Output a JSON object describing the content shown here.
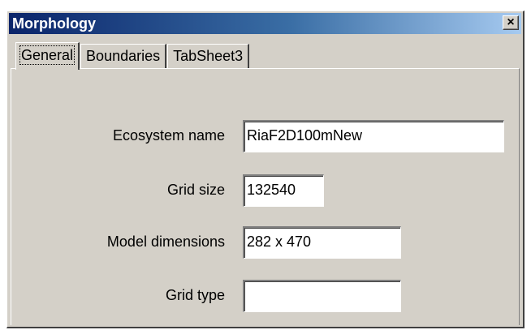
{
  "window": {
    "title": "Morphology",
    "close_label": "×"
  },
  "tabs": [
    {
      "label": "General",
      "active": true
    },
    {
      "label": "Boundaries",
      "active": false
    },
    {
      "label": "TabSheet3",
      "active": false
    }
  ],
  "form": {
    "ecosystem_name": {
      "label": "Ecosystem name",
      "value": "RiaF2D100mNew"
    },
    "grid_size": {
      "label": "Grid size",
      "value": "132540"
    },
    "model_dimensions": {
      "label": "Model dimensions",
      "value": "282 x 470"
    },
    "grid_type": {
      "label": "Grid type",
      "value": ""
    }
  },
  "colors": {
    "face": "#d4d0c8",
    "titlebar_start": "#0a246a",
    "titlebar_end": "#a6caf0"
  }
}
